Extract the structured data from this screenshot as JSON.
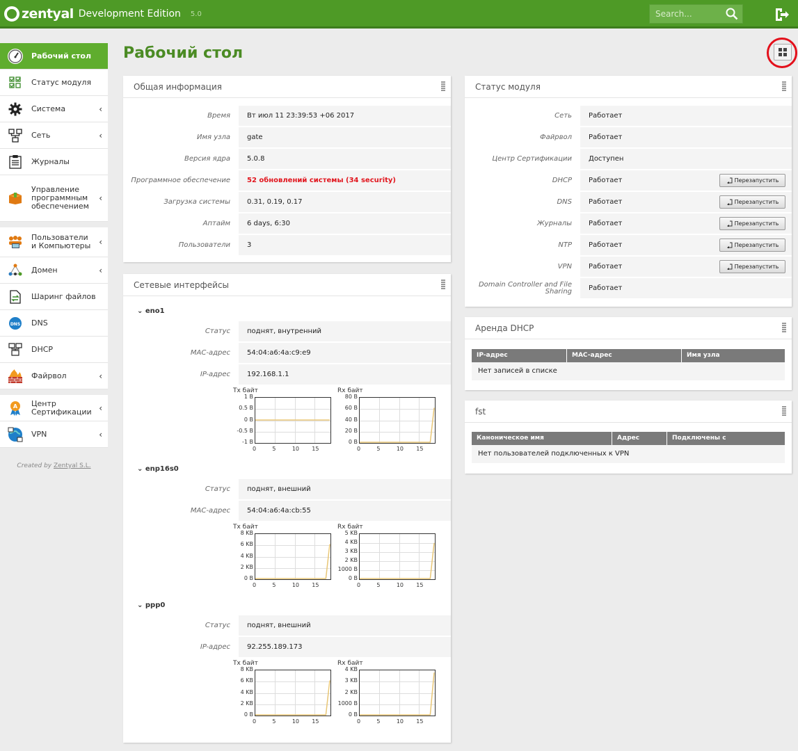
{
  "header": {
    "brand": "zentyal",
    "edition": "Development Edition",
    "version": "5.0",
    "search_placeholder": "Search..."
  },
  "sidebar": {
    "items": [
      {
        "label": "Рабочий стол",
        "icon": "dashboard-icon",
        "active": true
      },
      {
        "label": "Статус модуля",
        "icon": "module-status-icon"
      },
      {
        "label": "Система",
        "icon": "gear-icon",
        "arrow": true
      },
      {
        "label": "Сеть",
        "icon": "network-icon",
        "arrow": true
      },
      {
        "label": "Журналы",
        "icon": "logs-icon"
      },
      {
        "label": "Управление программным обеспечением",
        "icon": "software-package-icon",
        "arrow": true
      },
      {
        "label": "Пользователи и Компьютеры",
        "icon": "users-icon",
        "arrow": true,
        "gap": true
      },
      {
        "label": "Домен",
        "icon": "domain-icon",
        "arrow": true
      },
      {
        "label": "Шаринг файлов",
        "icon": "file-sharing-icon"
      },
      {
        "label": "DNS",
        "icon": "dns-icon"
      },
      {
        "label": "DHCP",
        "icon": "dhcp-icon"
      },
      {
        "label": "Файрвол",
        "icon": "firewall-icon",
        "arrow": true
      },
      {
        "label": "Центр Сертификации",
        "icon": "certificate-icon",
        "arrow": true,
        "gap": true
      },
      {
        "label": "VPN",
        "icon": "vpn-icon",
        "arrow": true
      }
    ],
    "arrow_glyph": "‹",
    "created_prefix": "Created by ",
    "created_link": "Zentyal S.L."
  },
  "page": {
    "title": "Рабочий стол"
  },
  "general": {
    "title": "Общая информация",
    "rows": [
      {
        "k": "Время",
        "v": "Вт июл 11 23:39:53 +06 2017"
      },
      {
        "k": "Имя узла",
        "v": "gate"
      },
      {
        "k": "Версия ядра",
        "v": "5.0.8"
      },
      {
        "k": "Программное обеспечение",
        "v": "52 обновлений системы (34 security)",
        "alert": true
      },
      {
        "k": "Загрузка системы",
        "v": "0.31, 0.19, 0.17"
      },
      {
        "k": "Аптайм",
        "v": "6 days, 6:30"
      },
      {
        "k": "Пользователи",
        "v": "3"
      }
    ]
  },
  "network": {
    "title": "Сетевые интерфейсы",
    "interfaces": [
      {
        "name": "eno1",
        "rows": [
          {
            "k": "Статус",
            "v": "поднят, внутренний"
          },
          {
            "k": "MAC-адрес",
            "v": "54:04:a6:4a:c9:e9"
          },
          {
            "k": "IP-адрес",
            "v": "192.168.1.1"
          }
        ],
        "tx": {
          "title": "Tx байт",
          "yticks": [
            "1 B",
            "0.5 B",
            "0 B",
            "-0.5 B",
            "-1 B"
          ],
          "ylim": [
            -1,
            1
          ],
          "x": [
            0,
            19
          ],
          "y": [
            0,
            0
          ],
          "color": "#e8c676"
        },
        "rx": {
          "title": "Rx байт",
          "yticks": [
            "80 B",
            "60 B",
            "40 B",
            "20 B",
            "0 B"
          ],
          "ylim": [
            0,
            80
          ],
          "x": [
            0,
            18,
            19
          ],
          "y": [
            0,
            0,
            62
          ],
          "color": "#e8c676"
        }
      },
      {
        "name": "enp16s0",
        "rows": [
          {
            "k": "Статус",
            "v": "поднят, внешний"
          },
          {
            "k": "MAC-адрес",
            "v": "54:04:a6:4a:cb:55"
          }
        ],
        "tx": {
          "title": "Tx байт",
          "yticks": [
            "8 KB",
            "6 KB",
            "4 KB",
            "2 KB",
            "0 B"
          ],
          "ylim": [
            0,
            8
          ],
          "x": [
            0,
            18,
            19
          ],
          "y": [
            0,
            0,
            6.2
          ],
          "color": "#e8c676"
        },
        "rx": {
          "title": "Rx байт",
          "yticks": [
            "5 KB",
            "4 KB",
            "3 KB",
            "2 KB",
            "1000 B",
            "0 B"
          ],
          "ylim": [
            0,
            5
          ],
          "x": [
            0,
            18,
            19
          ],
          "y": [
            0,
            0,
            4
          ],
          "color": "#e8c676"
        }
      },
      {
        "name": "ppp0",
        "rows": [
          {
            "k": "Статус",
            "v": "поднят, внешний"
          },
          {
            "k": "IP-адрес",
            "v": "92.255.189.173"
          }
        ],
        "tx": {
          "title": "Tx байт",
          "yticks": [
            "8 KB",
            "6 KB",
            "4 KB",
            "2 KB",
            "0 B"
          ],
          "ylim": [
            0,
            8
          ],
          "x": [
            0,
            18,
            19
          ],
          "y": [
            0,
            0,
            6.2
          ],
          "color": "#e8c676"
        },
        "rx": {
          "title": "Rx байт",
          "yticks": [
            "4 KB",
            "3 KB",
            "2 KB",
            "1000 B",
            "0 B"
          ],
          "ylim": [
            0,
            4
          ],
          "x": [
            0,
            18,
            19
          ],
          "y": [
            0,
            0,
            3.8
          ],
          "color": "#e8c676"
        }
      }
    ],
    "xticks": [
      "0",
      "5",
      "10",
      "15"
    ]
  },
  "modstatus": {
    "title": "Статус модуля",
    "button": "Перезапустить",
    "rows": [
      {
        "k": "Сеть",
        "v": "Работает"
      },
      {
        "k": "Файрвол",
        "v": "Работает"
      },
      {
        "k": "Центр Сертификации",
        "v": "Доступен"
      },
      {
        "k": "DHCP",
        "v": "Работает",
        "restart": true
      },
      {
        "k": "DNS",
        "v": "Работает",
        "restart": true
      },
      {
        "k": "Журналы",
        "v": "Работает",
        "restart": true
      },
      {
        "k": "NTP",
        "v": "Работает",
        "restart": true
      },
      {
        "k": "VPN",
        "v": "Работает",
        "restart": true
      },
      {
        "k": "Domain Controller and File Sharing",
        "v": "Работает"
      }
    ]
  },
  "dhcp": {
    "title": "Аренда DHCP",
    "cols": [
      "IP-адрес",
      "MAC-адрес",
      "Имя узла"
    ],
    "empty": "Нет записей в списке"
  },
  "fst": {
    "title": "fst",
    "cols": [
      "Каноническое имя",
      "Адрес",
      "Подключены с"
    ],
    "empty": "Нет пользователей подключенных к VPN"
  }
}
